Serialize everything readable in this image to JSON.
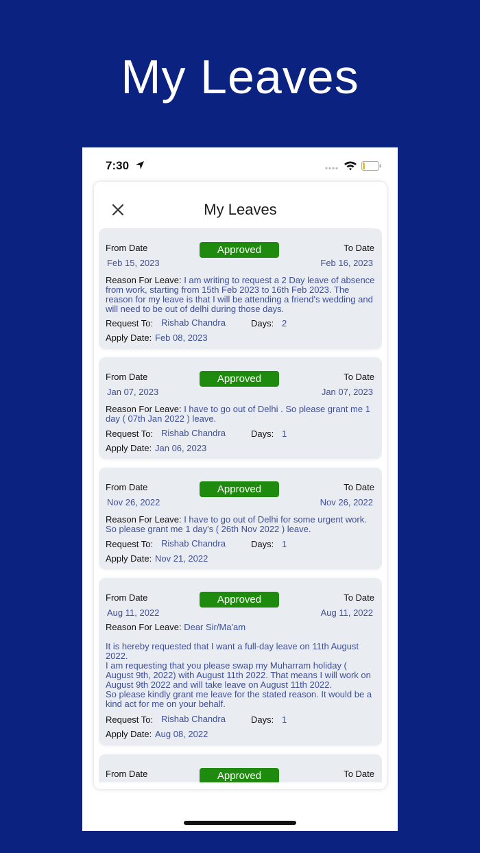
{
  "promo": {
    "title": "My Leaves"
  },
  "status_bar": {
    "time": "7:30"
  },
  "sheet": {
    "title": "My Leaves"
  },
  "labels": {
    "from_date": "From Date",
    "to_date": "To Date",
    "reason": "Reason For Leave:",
    "request_to": "Request To:",
    "days": "Days:",
    "apply_date": "Apply Date:"
  },
  "leaves": [
    {
      "status": "Approved",
      "from": "Feb 15, 2023",
      "to": "Feb 16, 2023",
      "reason": "I am writing to request a 2 Day leave of absence from work, starting from 15th Feb 2023 to 16th Feb 2023. The reason for my leave is that I will be attending a friend's wedding and will need to be out of delhi during those days.",
      "request_to": "Rishab Chandra",
      "days": "2",
      "apply_date": "Feb 08, 2023"
    },
    {
      "status": "Approved",
      "from": "Jan 07, 2023",
      "to": "Jan 07, 2023",
      "reason": "I have to go out of Delhi . So please grant me 1 day ( 07th Jan 2022 ) leave.",
      "request_to": "Rishab Chandra",
      "days": "1",
      "apply_date": "Jan 06, 2023"
    },
    {
      "status": "Approved",
      "from": "Nov 26, 2022",
      "to": "Nov 26, 2022",
      "reason": "I have to go out of Delhi for some urgent work. So please grant me 1 day's ( 26th Nov 2022 ) leave.",
      "request_to": "Rishab Chandra",
      "days": "1",
      "apply_date": "Nov 21, 2022"
    },
    {
      "status": "Approved",
      "from": "Aug 11, 2022",
      "to": "Aug 11, 2022",
      "reason": "Dear Sir/Ma'am\n\nIt is hereby requested that I want a full-day leave on 11th August 2022.\nI am requesting that you please swap my Muharram holiday ( August 9th, 2022) with August 11th 2022. That means I will work on August 9th 2022 and will take leave on August 11th 2022.\nSo please kindly grant me leave for the stated reason. It would be a kind act for me on your behalf.",
      "request_to": "Rishab Chandra",
      "days": "1",
      "apply_date": "Aug 08, 2022"
    },
    {
      "status": "Approved"
    }
  ]
}
